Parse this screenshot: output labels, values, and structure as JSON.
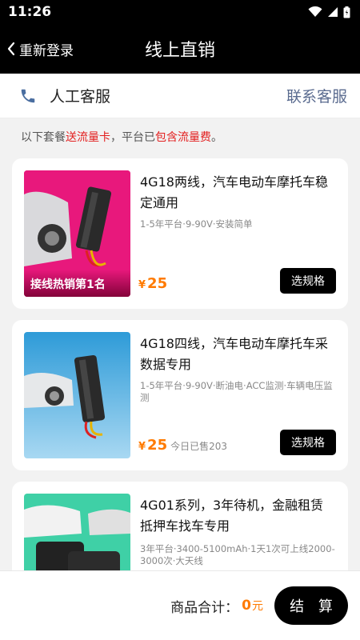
{
  "status": {
    "time": "11:26"
  },
  "nav": {
    "back_label": "重新登录",
    "title": "线上直销"
  },
  "service": {
    "label": "人工客服",
    "link": "联系客服"
  },
  "notice": {
    "p1": "以下套餐",
    "p2": "送流量卡",
    "p3": "，平台已",
    "p4": "包含流量费",
    "p5": "。"
  },
  "products": [
    {
      "title": "4G18两线，汽车电动车摩托车稳定通用",
      "desc": "1-5年平台·9-90V·安装简单",
      "price_symbol": "¥",
      "price": "25",
      "sold": "",
      "badge": "接线热销第1名",
      "button": "选规格"
    },
    {
      "title": "4G18四线，汽车电动车摩托车采数据专用",
      "desc": "1-5年平台·9-90V·断油电·ACC监测·车辆电压监测",
      "price_symbol": "¥",
      "price": "25",
      "sold": "今日已售203",
      "badge": "",
      "button": "选规格"
    },
    {
      "title": "4G01系列，3年待机，金融租赁抵押车找车专用",
      "desc": "3年平台·3400-5100mAh·1天1次可上线2000-3000次·大天线",
      "price_symbol": "",
      "price": "",
      "sold": "",
      "badge": "",
      "button": ""
    }
  ],
  "footer": {
    "total_label": "商品合计：",
    "total_value": "0",
    "total_unit": "元",
    "checkout": "结 算"
  }
}
